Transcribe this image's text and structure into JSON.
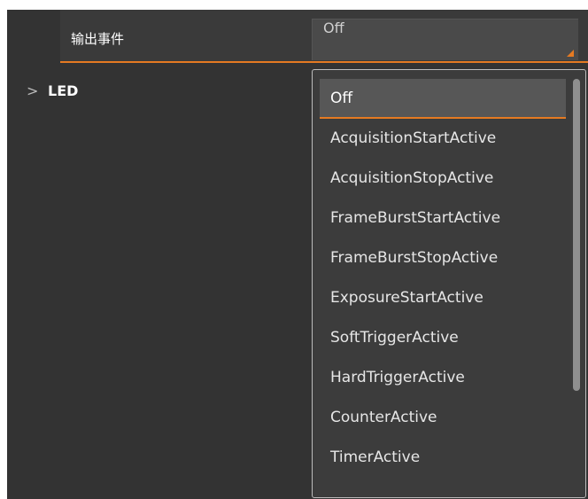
{
  "property": {
    "label": "输出事件",
    "value": "Off"
  },
  "tree": {
    "led_label": "LED"
  },
  "dropdown": {
    "options": [
      "Off",
      "AcquisitionStartActive",
      "AcquisitionStopActive",
      "FrameBurstStartActive",
      "FrameBurstStopActive",
      "ExposureStartActive",
      "SoftTriggerActive",
      "HardTriggerActive",
      "CounterActive",
      "TimerActive"
    ],
    "selected_index": 0
  },
  "colors": {
    "accent": "#e57a22",
    "panel_bg": "#333333",
    "dropdown_bg": "#3c3c3c",
    "selected_bg": "#575757"
  }
}
